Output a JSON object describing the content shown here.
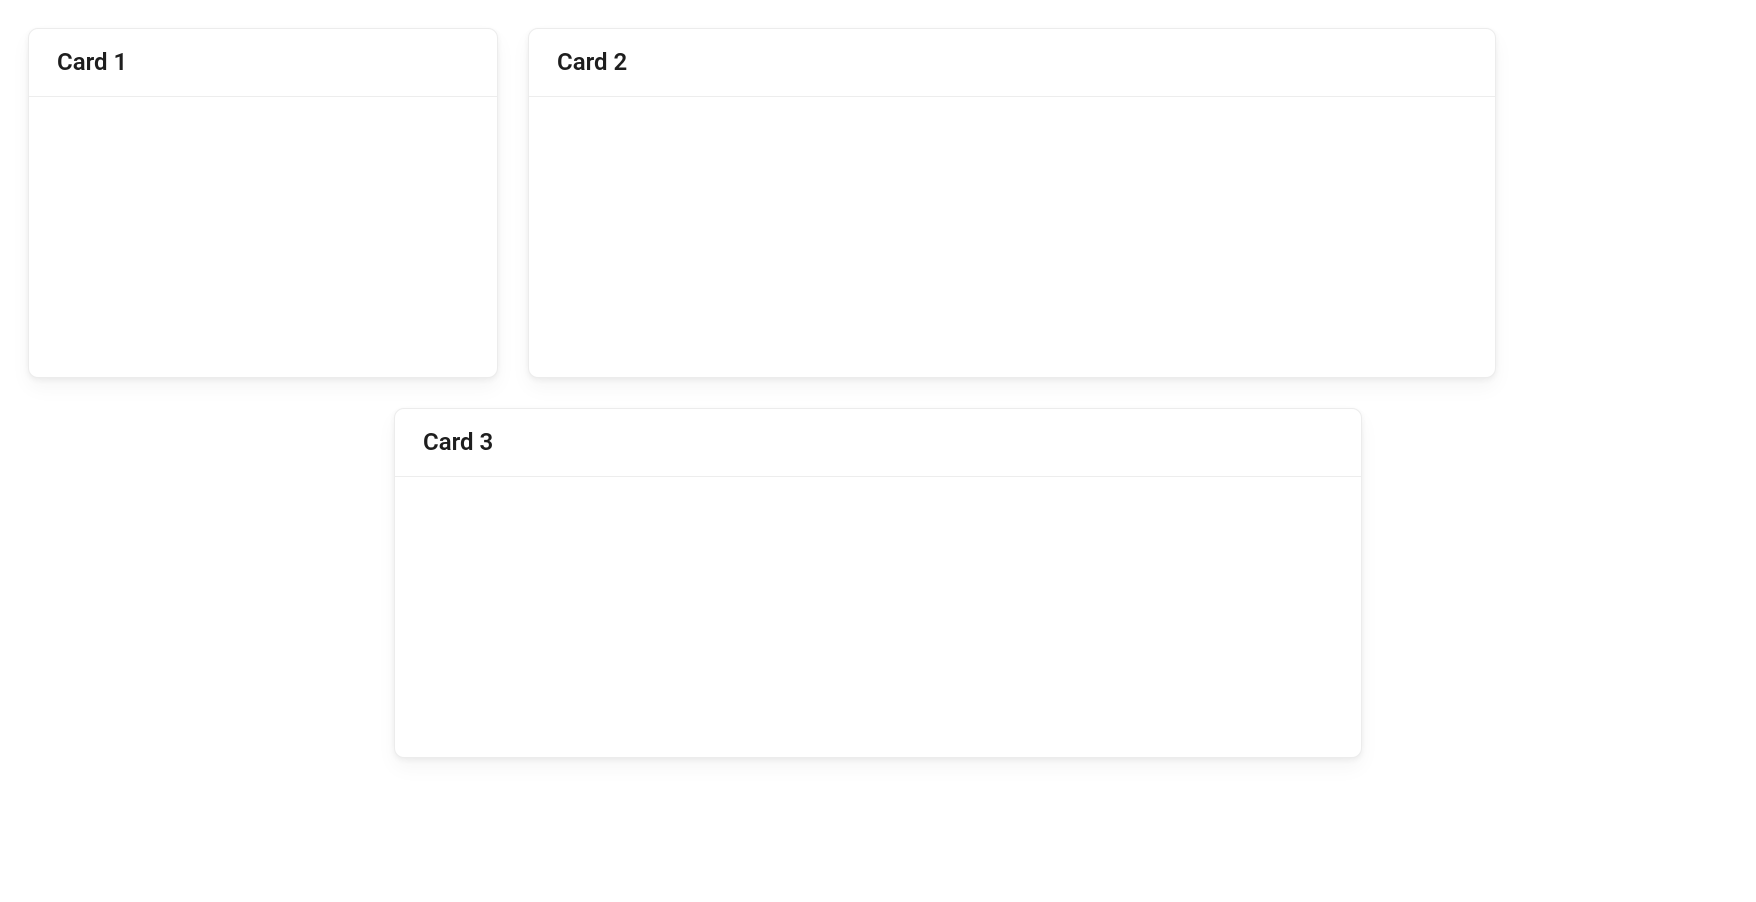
{
  "cards": [
    {
      "title": "Card 1"
    },
    {
      "title": "Card 2"
    },
    {
      "title": "Card 3"
    }
  ]
}
